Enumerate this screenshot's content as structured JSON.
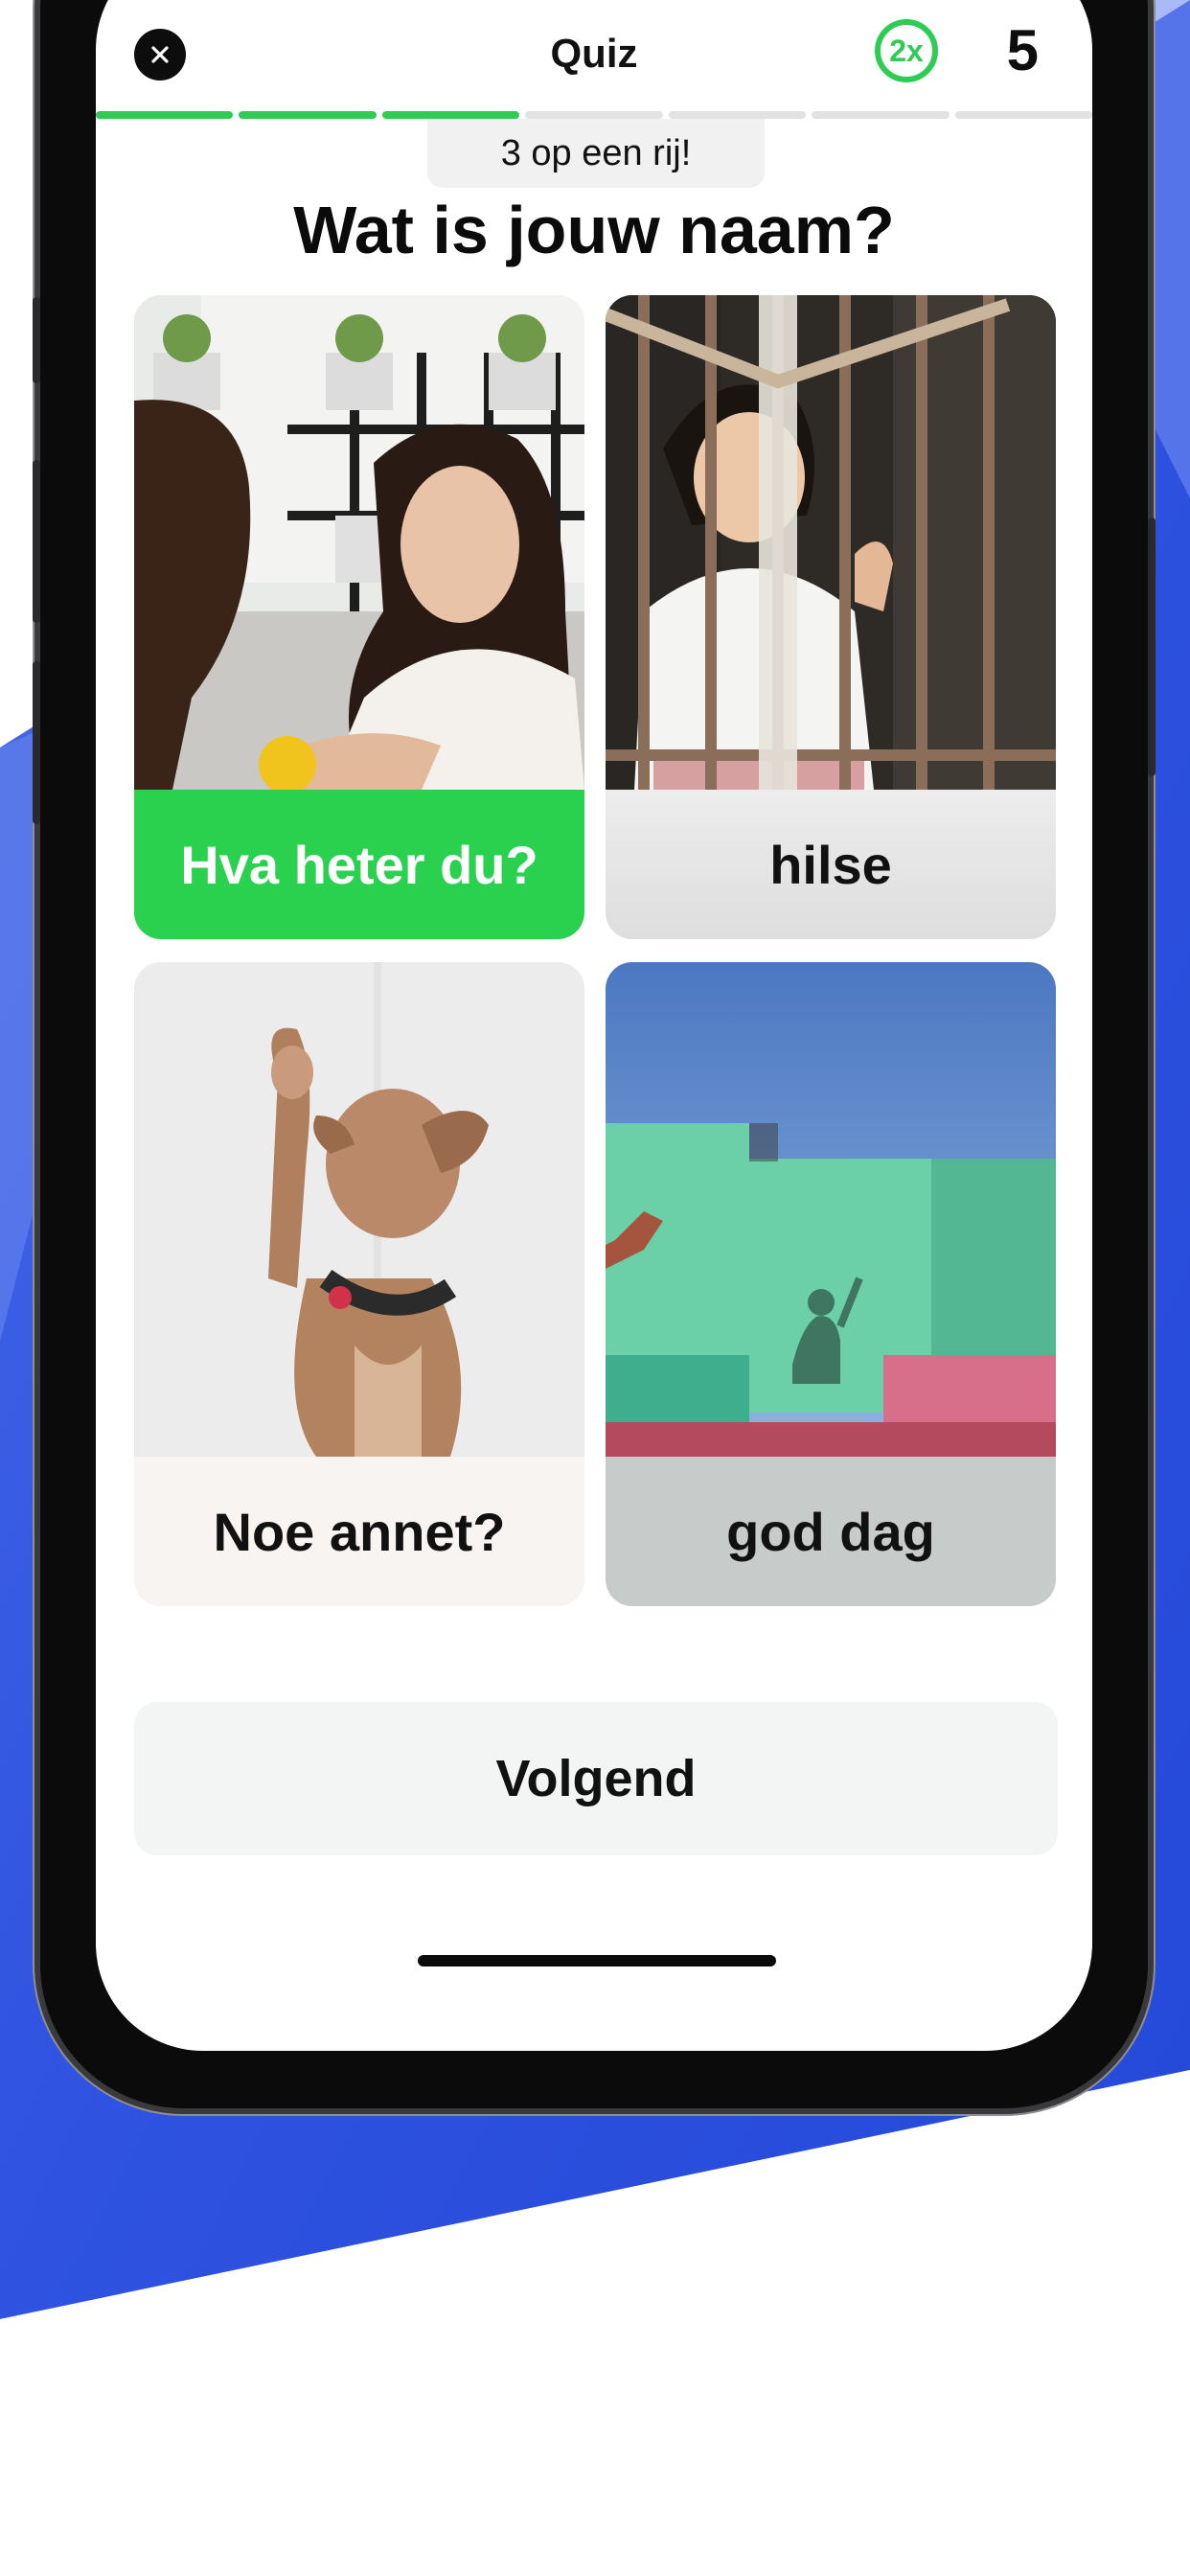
{
  "colors": {
    "accent_green": "#2ecc55",
    "selected_green": "#29d14f",
    "brand_blue": "#2f52e0"
  },
  "header": {
    "title": "Quiz",
    "close_icon": "close-icon",
    "streak_multiplier": "2x",
    "score": "5"
  },
  "progress": {
    "completed": 3,
    "total": 7
  },
  "streak_message": "3 op een rij!",
  "question": "Wat is jouw naam?",
  "options": [
    {
      "label": "Hva heter du?",
      "image": "two-women-talking-photo",
      "selected": true
    },
    {
      "label": "hilse",
      "image": "child-behind-window-bars-photo",
      "selected": false
    },
    {
      "label": "Noe annet?",
      "image": "dog-raising-paw-photo",
      "selected": false
    },
    {
      "label": "god dag",
      "image": "waving-shadow-on-wall-photo",
      "selected": false
    }
  ],
  "next_button": {
    "label": "Volgend"
  }
}
